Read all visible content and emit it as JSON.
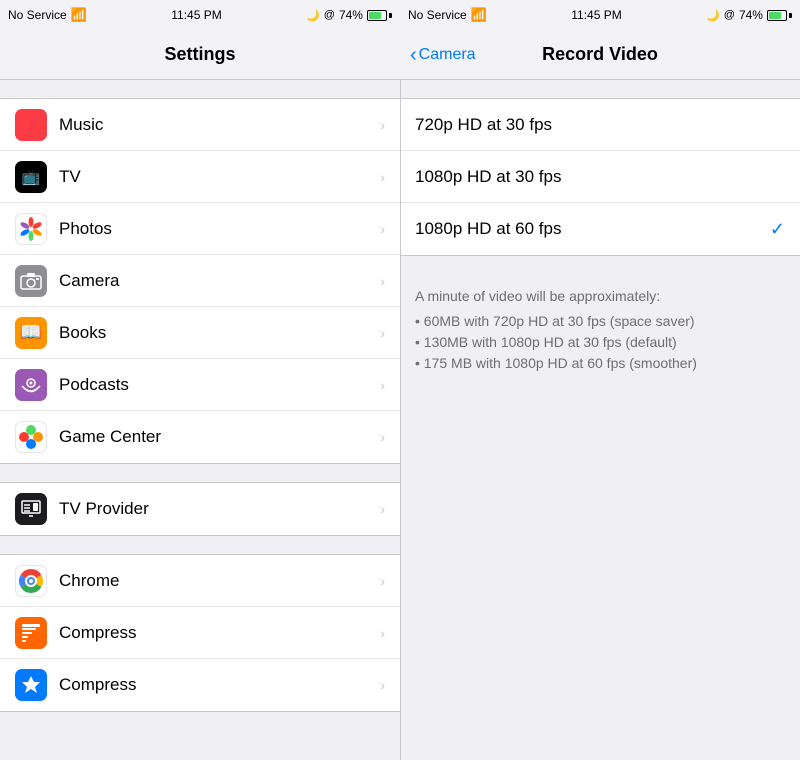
{
  "status": {
    "left": {
      "carrier": "No Service",
      "time": "11:45 PM",
      "battery": "74%"
    },
    "right": {
      "carrier": "No Service",
      "time": "11:45 PM",
      "battery": "74%"
    }
  },
  "left_nav": {
    "title": "Settings"
  },
  "right_nav": {
    "back_label": "Camera",
    "title": "Record Video"
  },
  "settings_groups": [
    {
      "id": "media",
      "items": [
        {
          "id": "music",
          "label": "Music",
          "icon": "music",
          "icon_color": "#fc3c44"
        },
        {
          "id": "tv",
          "label": "TV",
          "icon": "tv",
          "icon_color": "#000000"
        },
        {
          "id": "photos",
          "label": "Photos",
          "icon": "photos",
          "icon_color": "#ffffff"
        },
        {
          "id": "camera",
          "label": "Camera",
          "icon": "camera",
          "icon_color": "#8e8e93"
        },
        {
          "id": "books",
          "label": "Books",
          "icon": "books",
          "icon_color": "#fe9500"
        },
        {
          "id": "podcasts",
          "label": "Podcasts",
          "icon": "podcasts",
          "icon_color": "#9b59b6"
        },
        {
          "id": "gamecenter",
          "label": "Game Center",
          "icon": "gamecenter",
          "icon_color": "#ffffff"
        }
      ]
    },
    {
      "id": "provider",
      "items": [
        {
          "id": "tvprovider",
          "label": "TV Provider",
          "icon": "tvprovider",
          "icon_color": "#1c1c1e"
        }
      ]
    },
    {
      "id": "apps",
      "items": [
        {
          "id": "chrome",
          "label": "Chrome",
          "icon": "chrome",
          "icon_color": "#ffffff"
        },
        {
          "id": "compress1",
          "label": "Compress",
          "icon": "compress1",
          "icon_color": "#ff6600"
        },
        {
          "id": "compress2",
          "label": "Compress",
          "icon": "compress2",
          "icon_color": "#007aff"
        }
      ]
    }
  ],
  "video_options": [
    {
      "id": "720p30",
      "label": "720p HD at 30 fps",
      "selected": false
    },
    {
      "id": "1080p30",
      "label": "1080p HD at 30 fps",
      "selected": false
    },
    {
      "id": "1080p60",
      "label": "1080p HD at 60 fps",
      "selected": true
    }
  ],
  "video_info": {
    "title": "A minute of video will be approximately:",
    "items": [
      "• 60MB with 720p HD at 30 fps (space saver)",
      "• 130MB with 1080p HD at 30 fps (default)",
      "• 175 MB with 1080p HD at 60 fps (smoother)"
    ]
  }
}
